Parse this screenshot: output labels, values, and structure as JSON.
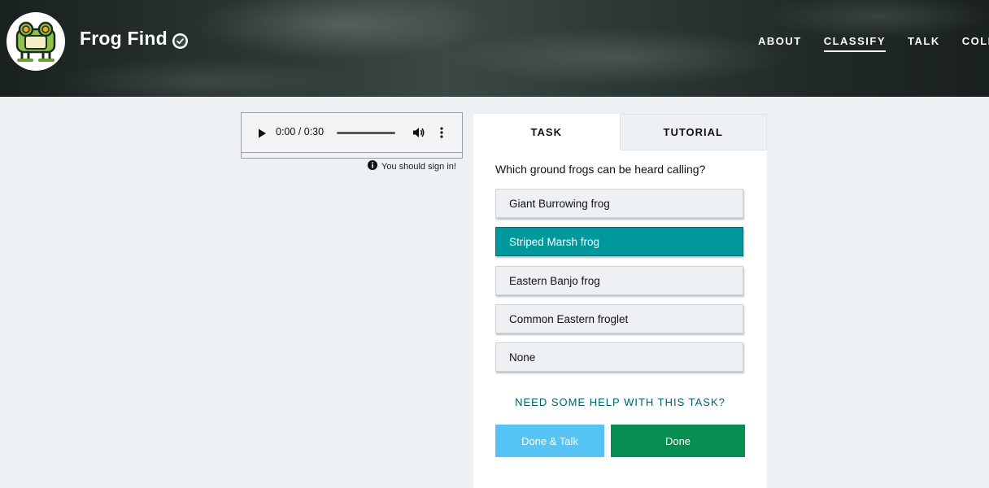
{
  "header": {
    "project_title": "Frog Find",
    "nav": [
      "ABOUT",
      "CLASSIFY",
      "TALK",
      "COLLECT"
    ],
    "active_nav": "CLASSIFY"
  },
  "audio": {
    "time": "0:00 / 0:30"
  },
  "notice": {
    "text": "You should sign in!"
  },
  "task": {
    "tabs": {
      "task": "TASK",
      "tutorial": "TUTORIAL"
    },
    "question": "Which ground frogs can be heard calling?",
    "answers": [
      {
        "label": "Giant Burrowing frog",
        "selected": false
      },
      {
        "label": "Striped Marsh frog",
        "selected": true
      },
      {
        "label": "Eastern Banjo frog",
        "selected": false
      },
      {
        "label": "Common Eastern froglet",
        "selected": false
      },
      {
        "label": "None",
        "selected": false
      }
    ],
    "help_link": "NEED SOME HELP WITH THIS TASK?",
    "done_talk_label": "Done & Talk",
    "done_label": "Done"
  },
  "colors": {
    "selected_answer": "#00979d",
    "done_button": "#078f52",
    "done_talk_button": "#56c3f5",
    "help_link": "#005d69",
    "page_bg": "#eef1f4"
  },
  "icons": [
    "frog-avatar-icon",
    "verified-check-icon",
    "play-icon",
    "volume-icon",
    "kebab-menu-icon",
    "info-icon"
  ]
}
